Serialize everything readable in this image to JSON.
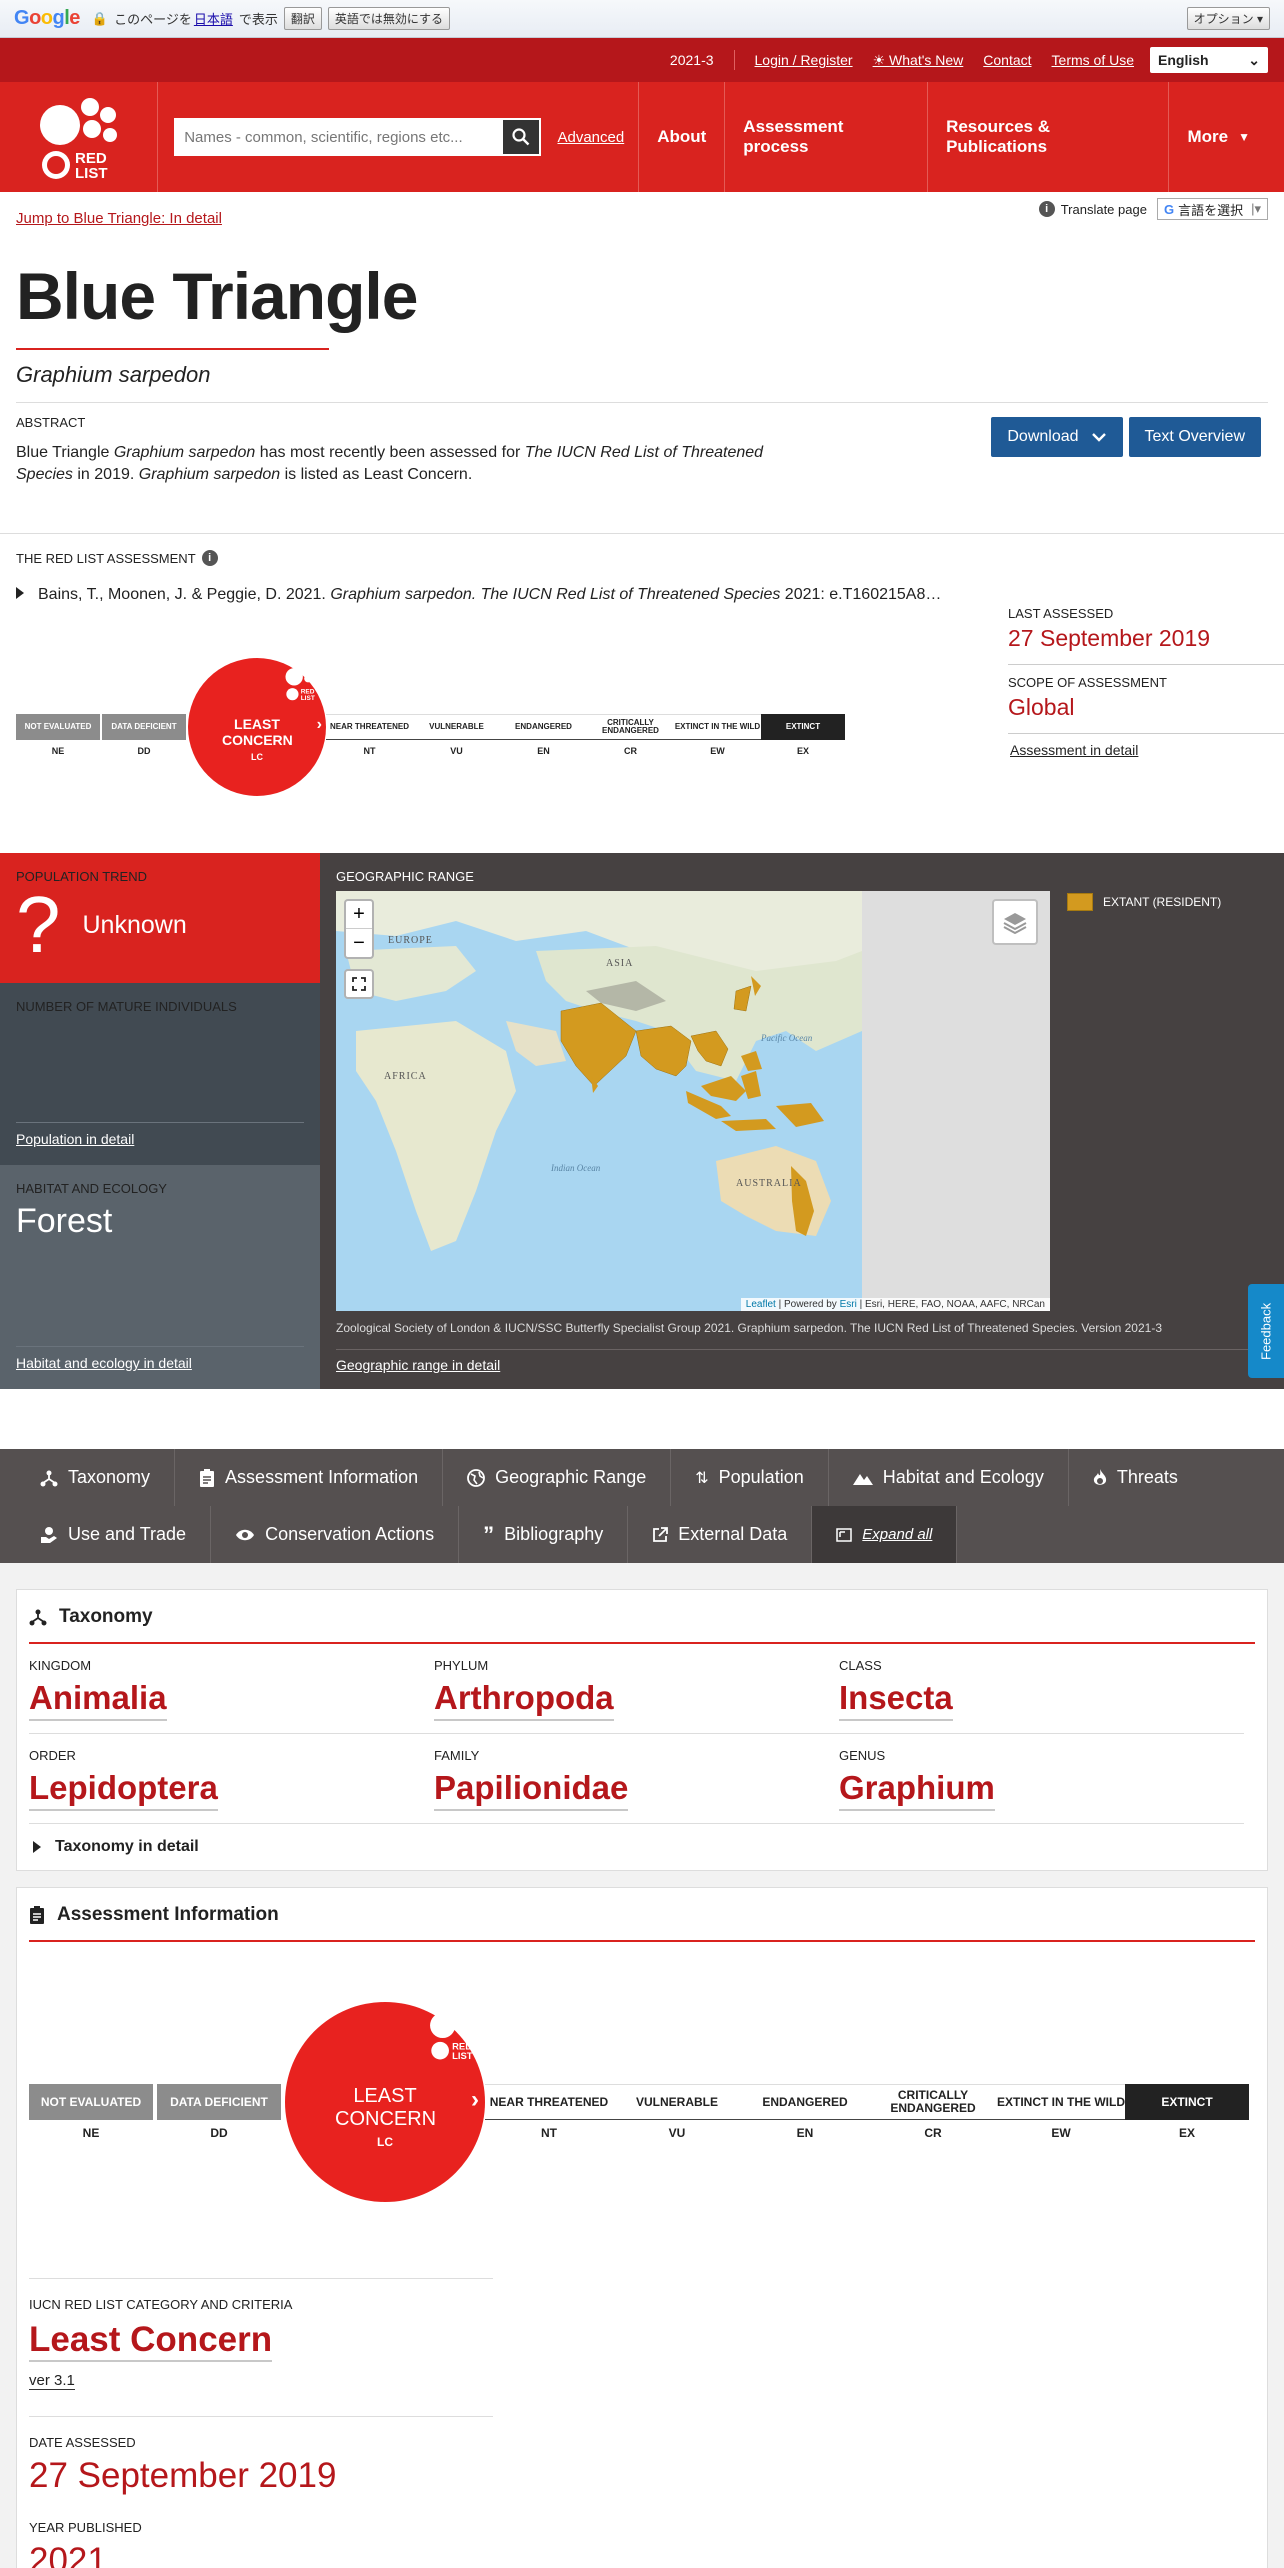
{
  "translate_bar": {
    "prefix": "このページを",
    "language": "日本語",
    "suffix": "で表示",
    "translate_btn": "翻訳",
    "never_btn": "英語では無効にする",
    "options_btn": "オプション ▾"
  },
  "topstrip": {
    "version": "2021-3",
    "login": "Login / Register",
    "whats_new": "What's New",
    "contact": "Contact",
    "terms": "Terms of Use",
    "language": "English"
  },
  "header": {
    "logo_text": "RED LIST",
    "search_placeholder": "Names - common, scientific, regions etc...",
    "advanced": "Advanced",
    "nav": [
      "About",
      "Assessment process",
      "Resources & Publications",
      "More"
    ]
  },
  "page": {
    "jump_link": "Jump to Blue Triangle: In detail",
    "translate_label": "Translate page",
    "translate_select": "言語を選択",
    "title": "Blue Triangle",
    "scientific_name": "Graphium sarpedon"
  },
  "abstract": {
    "heading": "ABSTRACT",
    "p1": "Blue Triangle ",
    "p2": "Graphium sarpedon",
    "p3": " has most recently been assessed for ",
    "p4": "The IUCN Red List of Threatened Species",
    "p5": " in 2019. ",
    "p6": "Graphium sarpedon",
    "p7": " is listed as Least Concern.",
    "download": "Download",
    "text_overview": "Text Overview"
  },
  "assessment": {
    "heading": "THE RED LIST ASSESSMENT",
    "citation_a": "Bains, T., Moonen, J. & Peggie, D. 2021. ",
    "citation_b": "Graphium sarpedon. The IUCN Red List of Threatened Species",
    "citation_c": " 2021: e.T160215A8…",
    "last_assessed_label": "LAST ASSESSED",
    "last_assessed": "27 September 2019",
    "scope_label": "SCOPE OF ASSESSMENT",
    "scope": "Global",
    "detail_link": "Assessment in detail"
  },
  "scale": {
    "pre": [
      {
        "label": "NOT EVALUATED",
        "abbr": "NE"
      },
      {
        "label": "DATA DEFICIENT",
        "abbr": "DD"
      }
    ],
    "current": {
      "label": "LEAST CONCERN",
      "abbr": "LC"
    },
    "post": [
      {
        "label": "NEAR THREATENED",
        "abbr": "NT"
      },
      {
        "label": "VULNERABLE",
        "abbr": "VU"
      },
      {
        "label": "ENDANGERED",
        "abbr": "EN"
      },
      {
        "label": "CRITICALLY ENDANGERED",
        "abbr": "CR"
      },
      {
        "label": "EXTINCT IN THE WILD",
        "abbr": "EW"
      },
      {
        "label": "EXTINCT",
        "abbr": "EX"
      }
    ]
  },
  "panels": {
    "pop_trend_label": "POPULATION TREND",
    "pop_trend": "Unknown",
    "mature_label": "NUMBER OF MATURE INDIVIDUALS",
    "pop_link": "Population in detail",
    "habitat_label": "HABITAT AND ECOLOGY",
    "habitat": "Forest",
    "habitat_link": "Habitat and ecology in detail",
    "geo_label": "GEOGRAPHIC RANGE",
    "legend": "EXTANT (RESIDENT)",
    "map_labels": [
      "EUROPE",
      "ASIA",
      "AFRICA",
      "Pacific Ocean",
      "Indian Ocean",
      "AUSTRALIA"
    ],
    "attribution_leaflet": "Leaflet",
    "attribution_mid": " | Powered by ",
    "attribution_esri": "Esri",
    "attribution_rest": " | Esri, HERE, FAO, NOAA, AAFC, NRCan",
    "caption": "Zoological Society of London & IUCN/SSC Butterfly Specialist Group 2021. Graphium sarpedon. The IUCN Red List of Threatened Species. Version 2021-3",
    "geo_link": "Geographic range in detail",
    "feedback": "Feedback",
    "legend_color": "#d39a1f"
  },
  "tabs": {
    "row1": [
      "Taxonomy",
      "Assessment Information",
      "Geographic Range",
      "Population",
      "Habitat and Ecology",
      "Threats"
    ],
    "row2": [
      "Use and Trade",
      "Conservation Actions",
      "Bibliography",
      "External Data"
    ],
    "expand": "Expand all"
  },
  "taxonomy": {
    "heading": "Taxonomy",
    "items": [
      {
        "label": "KINGDOM",
        "value": "Animalia"
      },
      {
        "label": "PHYLUM",
        "value": "Arthropoda"
      },
      {
        "label": "CLASS",
        "value": "Insecta"
      },
      {
        "label": "ORDER",
        "value": "Lepidoptera"
      },
      {
        "label": "FAMILY",
        "value": "Papilionidae"
      },
      {
        "label": "GENUS",
        "value": "Graphium"
      }
    ],
    "detail": "Taxonomy in detail"
  },
  "assess_info": {
    "heading": "Assessment Information",
    "category_label": "IUCN RED LIST CATEGORY AND CRITERIA",
    "category": "Least Concern",
    "version": "ver 3.1",
    "date_label": "DATE ASSESSED",
    "date": "27 September 2019",
    "year_label": "YEAR PUBLISHED",
    "year": "2021"
  },
  "colors": {
    "brand_red": "#d9231f",
    "dark_red": "#b5171b",
    "button_blue": "#1f5a96"
  }
}
